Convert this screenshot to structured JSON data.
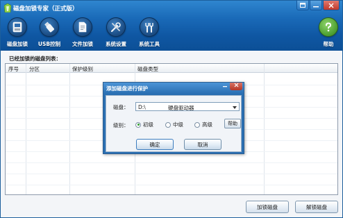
{
  "window": {
    "title": "磁盘加锁专家（正式版）",
    "controls": {
      "skin_icon": "skin-icon",
      "minimize_icon": "minimize-icon",
      "close_icon": "close-icon"
    }
  },
  "toolbar": {
    "items": [
      {
        "label": "磁盘加锁",
        "icon": "disk-icon"
      },
      {
        "label": "USB控制",
        "icon": "usb-icon"
      },
      {
        "label": "文件加锁",
        "icon": "file-icon"
      },
      {
        "label": "系统设置",
        "icon": "settings-icon"
      },
      {
        "label": "系统工具",
        "icon": "tools-icon"
      },
      {
        "label": "帮助",
        "icon": "help-icon"
      }
    ]
  },
  "main": {
    "list_caption": "已经加锁的磁盘列表：",
    "columns": [
      "序号",
      "分区",
      "保护级别",
      "磁盘类型"
    ],
    "rows": []
  },
  "footer": {
    "lock_button": "加锁磁盘",
    "unlock_button": "解锁磁盘"
  },
  "dialog": {
    "title": "添加磁盘进行保护",
    "disk_label": "磁盘：",
    "disk_selected": "D:\\",
    "disk_type": "硬盘驱动器",
    "level_label": "级别：",
    "levels": [
      {
        "label": "初级",
        "checked": true
      },
      {
        "label": "中级",
        "checked": false
      },
      {
        "label": "高级",
        "checked": false
      }
    ],
    "help_button": "帮助",
    "ok_button": "确定",
    "cancel_button": "取消"
  },
  "colors": {
    "header_top": "#2f86cf",
    "header_bottom": "#0c4f96",
    "dialog_frame": "#2a6fb2",
    "radio_checked": "#2f9e2f",
    "help_icon": "#4fa133"
  }
}
